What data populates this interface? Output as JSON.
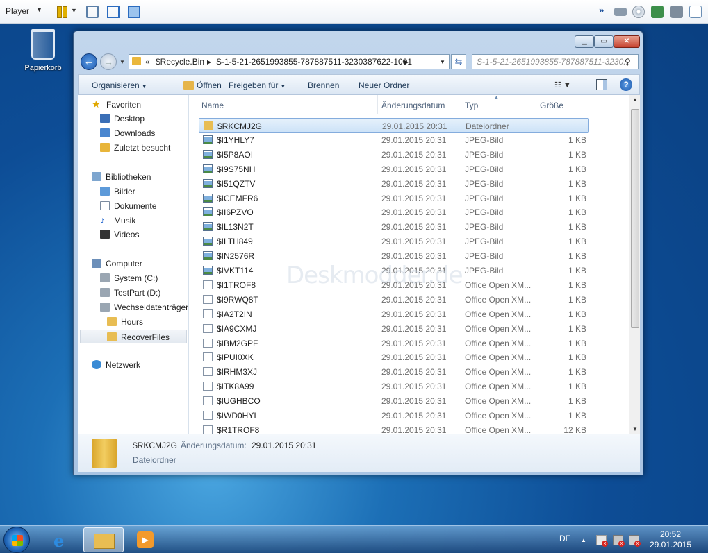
{
  "vmplayer": {
    "menu_label": "Player"
  },
  "desktop": {
    "recycle_bin_label": "Papierkorb"
  },
  "window": {
    "address": {
      "overflow": "«",
      "segments": [
        "$Recycle.Bin",
        "S-1-5-21-2651993855-787887511-3230387622-1001"
      ]
    },
    "search_placeholder": "S-1-5-21-2651993855-787887511-3230...",
    "toolbar": {
      "organize": "Organisieren",
      "open": "Öffnen",
      "share": "Freigeben für",
      "burn": "Brennen",
      "new_folder": "Neuer Ordner"
    },
    "nav": {
      "favorites": "Favoriten",
      "desktop": "Desktop",
      "downloads": "Downloads",
      "recent": "Zuletzt besucht",
      "libraries": "Bibliotheken",
      "pictures": "Bilder",
      "documents": "Dokumente",
      "music": "Musik",
      "videos": "Videos",
      "computer": "Computer",
      "system_c": "System (C:)",
      "testpart_d": "TestPart (D:)",
      "removable": "Wechseldatenträger",
      "hours": "Hours",
      "recoverfiles": "RecoverFiles",
      "network": "Netzwerk"
    },
    "columns": {
      "name": "Name",
      "date": "Änderungsdatum",
      "type": "Typ",
      "size": "Größe"
    },
    "files": [
      {
        "name": "$RKCMJ2G",
        "date": "29.01.2015 20:31",
        "type": "Dateiordner",
        "size": "",
        "icon": "folder"
      },
      {
        "name": "$I1YHLY7",
        "date": "29.01.2015 20:31",
        "type": "JPEG-Bild",
        "size": "1 KB",
        "icon": "jpeg"
      },
      {
        "name": "$I5P8AOI",
        "date": "29.01.2015 20:31",
        "type": "JPEG-Bild",
        "size": "1 KB",
        "icon": "jpeg"
      },
      {
        "name": "$I9S75NH",
        "date": "29.01.2015 20:31",
        "type": "JPEG-Bild",
        "size": "1 KB",
        "icon": "jpeg"
      },
      {
        "name": "$I51QZTV",
        "date": "29.01.2015 20:31",
        "type": "JPEG-Bild",
        "size": "1 KB",
        "icon": "jpeg"
      },
      {
        "name": "$ICEMFR6",
        "date": "29.01.2015 20:31",
        "type": "JPEG-Bild",
        "size": "1 KB",
        "icon": "jpeg"
      },
      {
        "name": "$II6PZVO",
        "date": "29.01.2015 20:31",
        "type": "JPEG-Bild",
        "size": "1 KB",
        "icon": "jpeg"
      },
      {
        "name": "$IL13N2T",
        "date": "29.01.2015 20:31",
        "type": "JPEG-Bild",
        "size": "1 KB",
        "icon": "jpeg"
      },
      {
        "name": "$ILTH849",
        "date": "29.01.2015 20:31",
        "type": "JPEG-Bild",
        "size": "1 KB",
        "icon": "jpeg"
      },
      {
        "name": "$IN2576R",
        "date": "29.01.2015 20:31",
        "type": "JPEG-Bild",
        "size": "1 KB",
        "icon": "jpeg"
      },
      {
        "name": "$IVKT114",
        "date": "29.01.2015 20:31",
        "type": "JPEG-Bild",
        "size": "1 KB",
        "icon": "jpeg"
      },
      {
        "name": "$I1TROF8",
        "date": "29.01.2015 20:31",
        "type": "Office Open XM...",
        "size": "1 KB",
        "icon": "doc"
      },
      {
        "name": "$I9RWQ8T",
        "date": "29.01.2015 20:31",
        "type": "Office Open XM...",
        "size": "1 KB",
        "icon": "doc"
      },
      {
        "name": "$IA2T2IN",
        "date": "29.01.2015 20:31",
        "type": "Office Open XM...",
        "size": "1 KB",
        "icon": "doc"
      },
      {
        "name": "$IA9CXMJ",
        "date": "29.01.2015 20:31",
        "type": "Office Open XM...",
        "size": "1 KB",
        "icon": "doc"
      },
      {
        "name": "$IBM2GPF",
        "date": "29.01.2015 20:31",
        "type": "Office Open XM...",
        "size": "1 KB",
        "icon": "doc"
      },
      {
        "name": "$IPUI0XK",
        "date": "29.01.2015 20:31",
        "type": "Office Open XM...",
        "size": "1 KB",
        "icon": "doc"
      },
      {
        "name": "$IRHM3XJ",
        "date": "29.01.2015 20:31",
        "type": "Office Open XM...",
        "size": "1 KB",
        "icon": "doc"
      },
      {
        "name": "$ITK8A99",
        "date": "29.01.2015 20:31",
        "type": "Office Open XM...",
        "size": "1 KB",
        "icon": "doc"
      },
      {
        "name": "$IUGHBCO",
        "date": "29.01.2015 20:31",
        "type": "Office Open XM...",
        "size": "1 KB",
        "icon": "doc"
      },
      {
        "name": "$IWD0HYI",
        "date": "29.01.2015 20:31",
        "type": "Office Open XM...",
        "size": "1 KB",
        "icon": "doc"
      },
      {
        "name": "$R1TROF8",
        "date": "29.01.2015 20:31",
        "type": "Office Open XM...",
        "size": "12 KB",
        "icon": "doc"
      }
    ],
    "watermark": "Deskmodder.de",
    "details": {
      "name": "$RKCMJ2G",
      "label": "Änderungsdatum:",
      "value": "29.01.2015 20:31",
      "type": "Dateiordner"
    }
  },
  "taskbar": {
    "language": "DE",
    "time": "20:52",
    "date": "29.01.2015"
  }
}
